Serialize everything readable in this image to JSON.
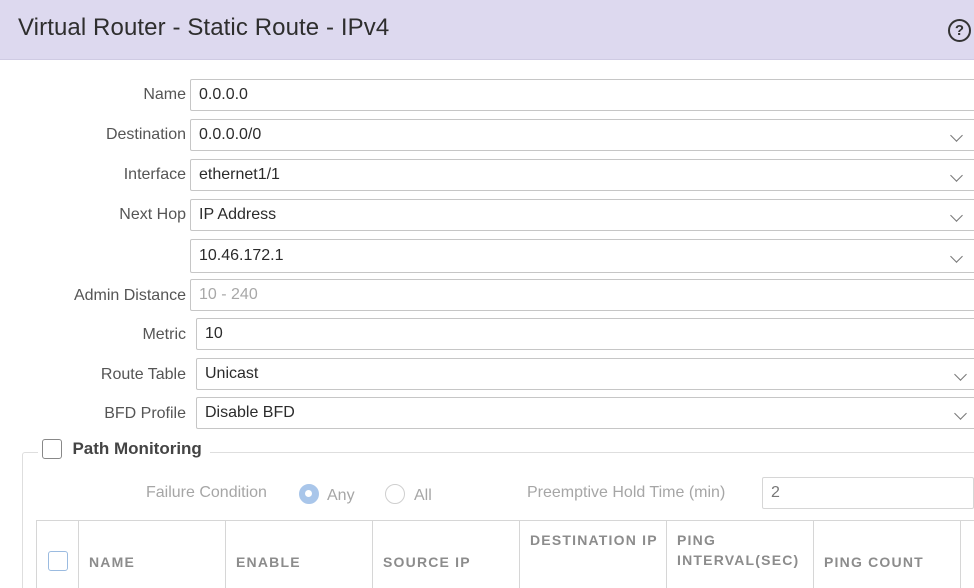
{
  "dialog": {
    "title": "Virtual Router - Static Route - IPv4",
    "help_glyph": "?"
  },
  "form": {
    "name": {
      "label": "Name",
      "value": "0.0.0.0"
    },
    "destination": {
      "label": "Destination",
      "value": "0.0.0.0/0"
    },
    "interface": {
      "label": "Interface",
      "value": "ethernet1/1"
    },
    "next_hop": {
      "label": "Next Hop",
      "value": "IP Address",
      "address": "10.46.172.1"
    },
    "admin_distance": {
      "label": "Admin Distance",
      "placeholder": "10 - 240"
    },
    "metric": {
      "label": "Metric",
      "value": "10"
    },
    "route_table": {
      "label": "Route Table",
      "value": "Unicast"
    },
    "bfd_profile": {
      "label": "BFD Profile",
      "value": "Disable BFD"
    }
  },
  "path_monitoring": {
    "label": "Path Monitoring",
    "checked": false,
    "failure_condition_label": "Failure Condition",
    "options": [
      {
        "label": "Any",
        "selected": true
      },
      {
        "label": "All",
        "selected": false
      }
    ],
    "preemptive_label": "Preemptive Hold Time (min)",
    "preemptive_value": "2",
    "columns": [
      "NAME",
      "ENABLE",
      "SOURCE IP",
      "DESTINATION IP",
      "PING INTERVAL(SEC)",
      "PING COUNT"
    ]
  },
  "colors": {
    "header_bg": "#ddd9ef",
    "radio_selected": "#a9c6ea"
  }
}
